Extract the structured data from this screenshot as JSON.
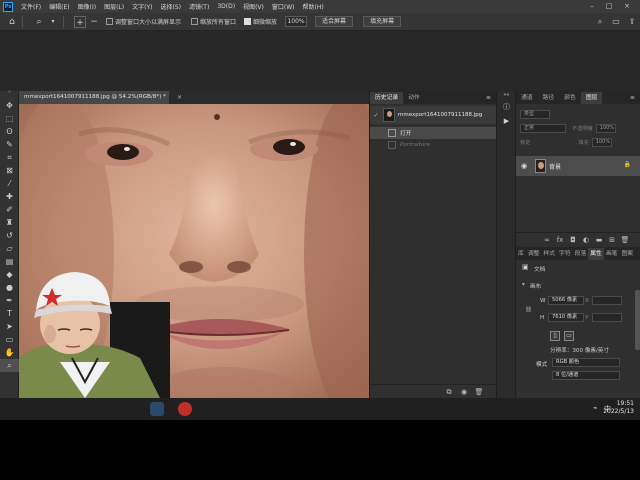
{
  "app": {
    "logo": "Ps",
    "menu": [
      "文件(F)",
      "编辑(E)",
      "图像(I)",
      "图层(L)",
      "文字(Y)",
      "选择(S)",
      "滤镜(T)",
      "3D(D)",
      "视图(V)",
      "窗口(W)",
      "帮助(H)"
    ]
  },
  "options_bar": {
    "resize_windows_label": "调整窗口大小以满屏显示",
    "resize_windows_checked": false,
    "zoom_all_label": "缩放所有窗口",
    "zoom_all_checked": false,
    "scrubby_zoom_label": "细微缩放",
    "scrubby_zoom_checked": true,
    "zoom_value": "100%",
    "fit_screen_label": "适合屏幕",
    "fill_screen_label": "填充屏幕"
  },
  "document": {
    "tab_title": "mmexport1641007911188.jpg @ 54.2%(RGB/8*) *",
    "close_glyph": "×"
  },
  "history_panel": {
    "tabs": [
      "历史记录",
      "动作"
    ],
    "active_tab": 0,
    "snapshot_name": "mmexport1641007911188.jpg",
    "states": [
      {
        "label": "打开",
        "selected": true,
        "dimmed": false
      },
      {
        "label": "Portraiture",
        "selected": false,
        "dimmed": true
      }
    ]
  },
  "layers_panel": {
    "tabs": [
      "通道",
      "路径",
      "颜色",
      "图层"
    ],
    "active_tab": 3,
    "kind_filter": "类型",
    "blend_mode": "正常",
    "opacity_label": "不透明度",
    "opacity_value": "100%",
    "lock_label": "锁定",
    "fill_label": "填充",
    "fill_value": "100%",
    "layer_name": "背景"
  },
  "properties_panel": {
    "tabs": [
      "库",
      "调整",
      "样式",
      "字符",
      "段落",
      "属性",
      "画笔",
      "图案"
    ],
    "active_tab": 5,
    "doc_label": "文档",
    "section_title": "画布",
    "width_label": "W",
    "width_value": "5066 像素",
    "height_label": "H",
    "height_value": "7610 像素",
    "x_label": "X",
    "y_label": "Y",
    "resolution": "分辨率：300 像素/英寸",
    "mode_label": "模式",
    "mode_value": "RGB 颜色",
    "bit_depth": "8 位/通道"
  },
  "taskbar": {
    "time": "19:51",
    "date": "2022/5/13"
  },
  "colors": {
    "accent": "#31a8ff",
    "panel_bg": "#2f2f2f",
    "selected_row": "#4d4d4d"
  }
}
